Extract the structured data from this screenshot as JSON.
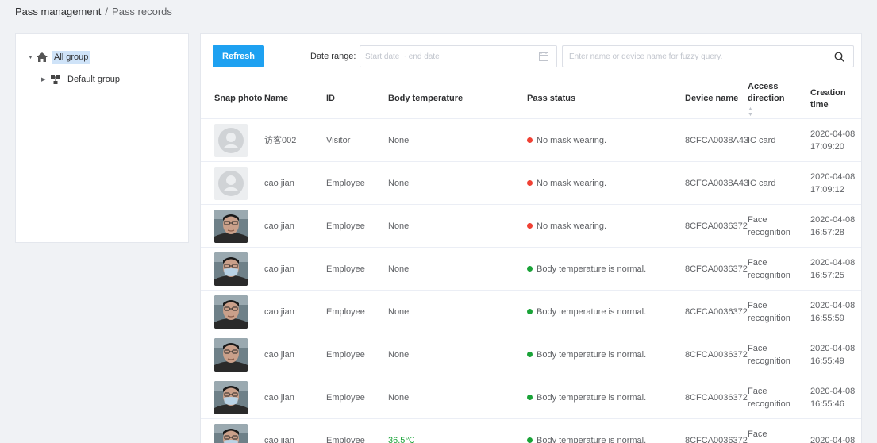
{
  "breadcrumb": {
    "parent": "Pass management",
    "separator": "/",
    "current": "Pass records"
  },
  "tree": {
    "root_label": "All group",
    "child_label": "Default group"
  },
  "toolbar": {
    "refresh_label": "Refresh",
    "date_label": "Date range:",
    "date_placeholder": "Start date ~ end date",
    "search_placeholder": "Enter name or device name for fuzzy query."
  },
  "table": {
    "headers": {
      "snap_photo": "Snap photo",
      "name": "Name",
      "id": "ID",
      "body_temperature": "Body temperature",
      "pass_status": "Pass status",
      "device_name": "Device name",
      "access_direction": "Access direction",
      "creation_time": "Creation time"
    },
    "rows": [
      {
        "photo": "placeholder",
        "name": "访客002",
        "id": "Visitor",
        "temp": "None",
        "status": "No mask wearing.",
        "status_color": "#f04134",
        "device": "8CFCA0038A43",
        "direction": "IC card",
        "time": "2020-04-08 17:09:20"
      },
      {
        "photo": "placeholder",
        "name": "cao jian",
        "id": "Employee",
        "temp": "None",
        "status": "No mask wearing.",
        "status_color": "#f04134",
        "device": "8CFCA0038A43",
        "direction": "IC card",
        "time": "2020-04-08 17:09:12"
      },
      {
        "photo": "face",
        "name": "cao jian",
        "id": "Employee",
        "temp": "None",
        "status": "No mask wearing.",
        "status_color": "#f04134",
        "device": "8CFCA0036372",
        "direction": "Face recognition",
        "time": "2020-04-08 16:57:28"
      },
      {
        "photo": "face-mask",
        "name": "cao jian",
        "id": "Employee",
        "temp": "None",
        "status": "Body temperature is normal.",
        "status_color": "#1aa338",
        "device": "8CFCA0036372",
        "direction": "Face recognition",
        "time": "2020-04-08 16:57:25"
      },
      {
        "photo": "face",
        "name": "cao jian",
        "id": "Employee",
        "temp": "None",
        "status": "Body temperature is normal.",
        "status_color": "#1aa338",
        "device": "8CFCA0036372",
        "direction": "Face recognition",
        "time": "2020-04-08 16:55:59"
      },
      {
        "photo": "face",
        "name": "cao jian",
        "id": "Employee",
        "temp": "None",
        "status": "Body temperature is normal.",
        "status_color": "#1aa338",
        "device": "8CFCA0036372",
        "direction": "Face recognition",
        "time": "2020-04-08 16:55:49"
      },
      {
        "photo": "face-mask",
        "name": "cao jian",
        "id": "Employee",
        "temp": "None",
        "status": "Body temperature is normal.",
        "status_color": "#1aa338",
        "device": "8CFCA0036372",
        "direction": "Face recognition",
        "time": "2020-04-08 16:55:46"
      },
      {
        "photo": "face-mask",
        "name": "cao jian",
        "id": "Employee",
        "temp": "36.5℃",
        "temp_normal": true,
        "status": "Body temperature is normal.",
        "status_color": "#1aa338",
        "device": "8CFCA0036372",
        "direction": "Face recognition",
        "time": "2020-04-08"
      }
    ]
  },
  "colors": {
    "primary": "#1ea1f1",
    "danger": "#f04134",
    "success": "#1aa338",
    "selected_bg": "#cfe3f8"
  },
  "icons": {
    "home": "home-icon",
    "group": "group-icon",
    "calendar": "calendar-icon",
    "search": "search-icon"
  }
}
